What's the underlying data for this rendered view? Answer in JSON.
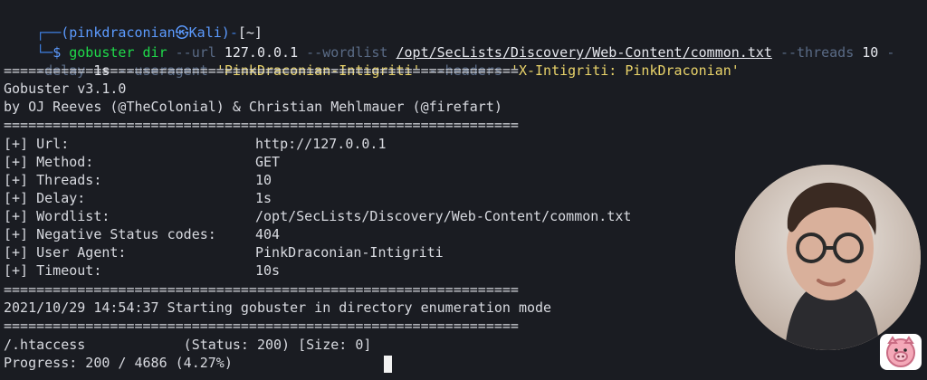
{
  "terminal": {
    "prompt_user": "(pinkdraconian㉿Kali)",
    "prompt_dir": "[~]",
    "cmd_parts": {
      "p1": "gobuster dir ",
      "p2": "--url",
      "p3": " 127.0.0.1 ",
      "p4": "--wordlist",
      "p5": " ",
      "p6": "/opt/SecLists/Discovery/Web-Content/common.txt",
      "p7": " ",
      "p8": "--threads",
      "p9": " 10 ",
      "p10": "-",
      "p11": "-delay",
      "p12": " 1s ",
      "p13": "--useragent",
      "p14": " ",
      "p15": "'PinkDraconian-Intigriti'",
      "p16": " ",
      "p17": "--headers",
      "p18": " ",
      "p19": "'X-Intigriti: PinkDraconian'"
    },
    "separator": "===============================================================",
    "banner_title": "Gobuster v3.1.0",
    "banner_by": "by OJ Reeves (@TheColonial) & Christian Mehlmauer (@firefart)",
    "config": [
      {
        "key": "[+] Url:",
        "value": "http://127.0.0.1"
      },
      {
        "key": "[+] Method:",
        "value": "GET"
      },
      {
        "key": "[+] Threads:",
        "value": "10"
      },
      {
        "key": "[+] Delay:",
        "value": "1s"
      },
      {
        "key": "[+] Wordlist:",
        "value": "/opt/SecLists/Discovery/Web-Content/common.txt"
      },
      {
        "key": "[+] Negative Status codes:",
        "value": "404"
      },
      {
        "key": "[+] User Agent:",
        "value": "PinkDraconian-Intigriti"
      },
      {
        "key": "[+] Timeout:",
        "value": "10s"
      }
    ],
    "start_line": "2021/10/29 14:54:37 Starting gobuster in directory enumeration mode",
    "result_line": "/.htaccess            (Status: 200) [Size: 0]",
    "progress_line": "Progress: 200 / 4686 (4.27%)"
  },
  "colors": {
    "background": "#1a1c22",
    "prompt_blue": "#3f7fe0",
    "prompt_green": "#1fd94a",
    "flag": "#5a6b86",
    "string": "#e9d36a"
  },
  "icons": {
    "webcam": "webcam-overlay",
    "logo": "pig-icon"
  }
}
